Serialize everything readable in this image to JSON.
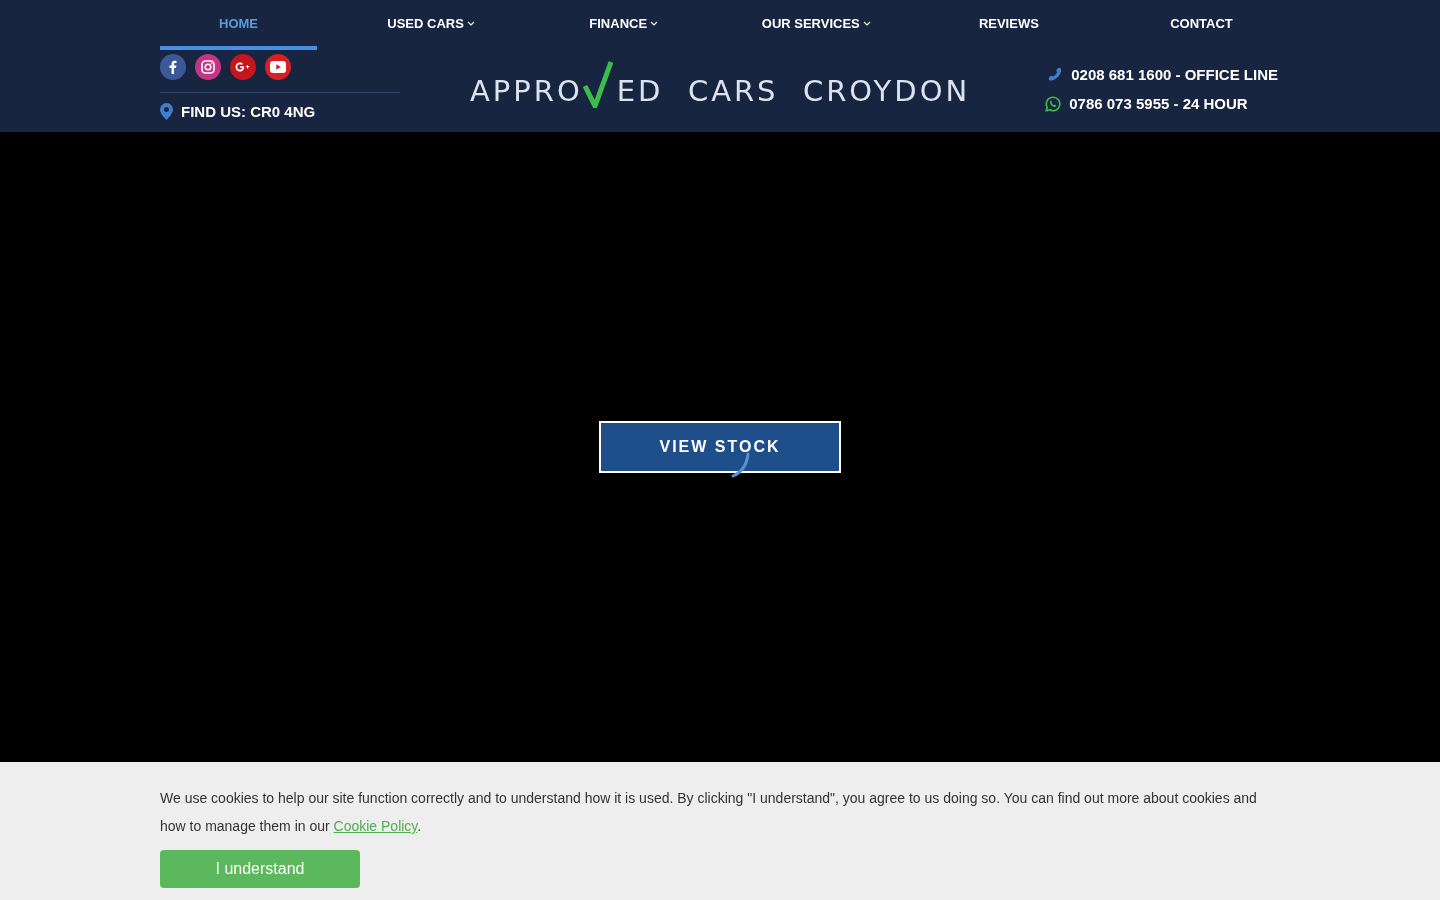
{
  "nav": [
    {
      "label": "HOME",
      "selected": true,
      "dropdown": false
    },
    {
      "label": "USED CARS",
      "selected": false,
      "dropdown": true
    },
    {
      "label": "FINANCE",
      "selected": false,
      "dropdown": true
    },
    {
      "label": "OUR SERVICES",
      "selected": false,
      "dropdown": true
    },
    {
      "label": "REVIEWS",
      "selected": false,
      "dropdown": false
    },
    {
      "label": "CONTACT",
      "selected": false,
      "dropdown": false
    }
  ],
  "social": [
    {
      "kind": "facebook",
      "color": "#3b5998"
    },
    {
      "kind": "instagram",
      "color": "#c13584"
    },
    {
      "kind": "googleplus",
      "color": "#c4161c"
    },
    {
      "kind": "youtube",
      "color": "#d81f26"
    }
  ],
  "find_us": "FIND US: CR0 4NG",
  "logo": {
    "before": "APPRO",
    "after": "ED  CARS  CROYDON"
  },
  "phones": [
    {
      "kind": "phone",
      "text": "0208 681 1600 - OFFICE LINE"
    },
    {
      "kind": "whatsapp",
      "text": "0786 073 5955 - 24 HOUR"
    }
  ],
  "hero": {
    "button": "VIEW STOCK"
  },
  "cookie": {
    "text_before": "We use cookies to help our site function correctly and to understand how it is used. By clicking \"I understand\", you agree to us doing so. You can find out more about cookies and how to manage them in our ",
    "link": "Cookie Policy",
    "text_after": ".",
    "button": "I understand"
  }
}
